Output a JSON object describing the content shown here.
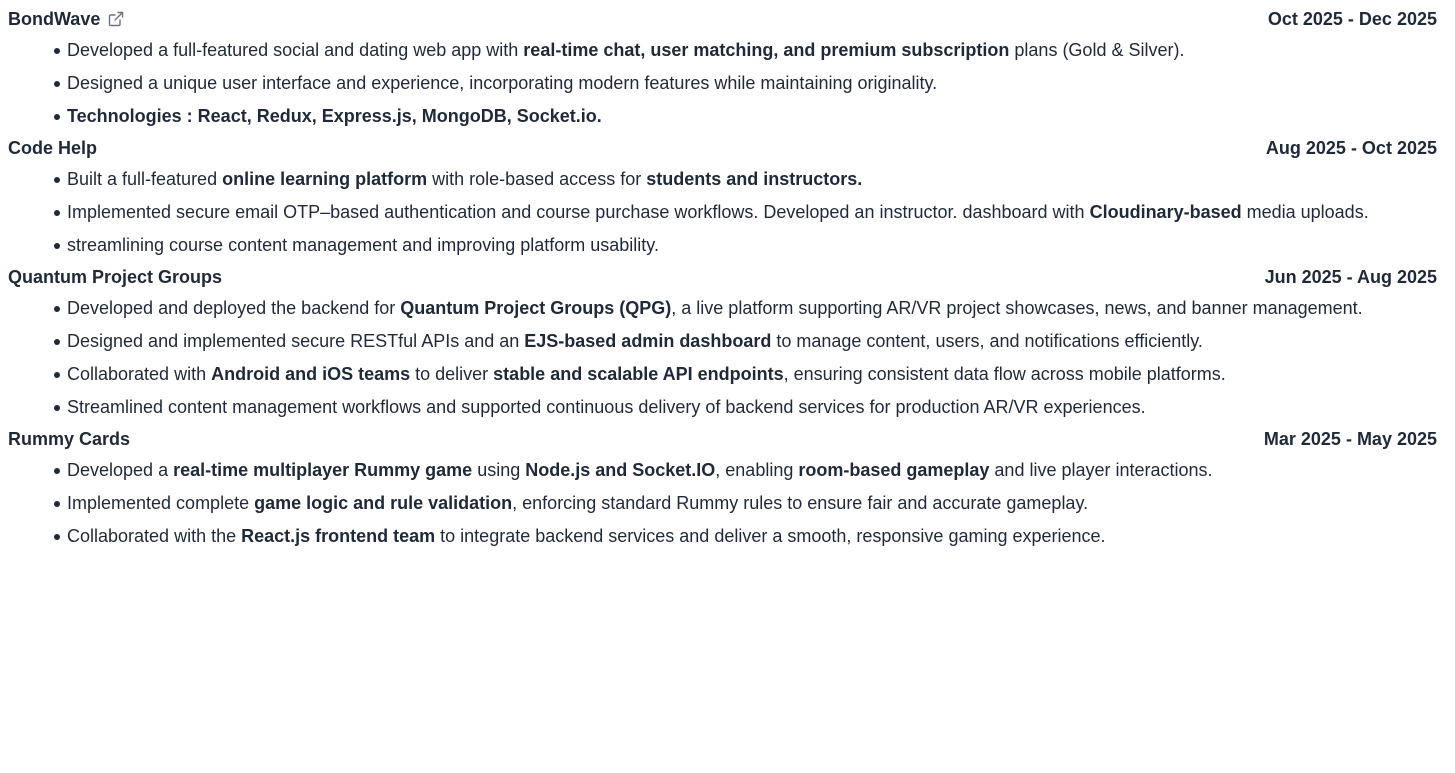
{
  "projects": [
    {
      "title": "BondWave",
      "has_link": true,
      "link_icon": "external-link-icon",
      "dates": "Oct 2025 - Dec 2025",
      "bullets": [
        [
          {
            "t": "Developed a full-featured social and dating web app with "
          },
          {
            "t": "real-time chat, user matching, and premium subscription",
            "b": true
          },
          {
            "t": " plans (Gold & Silver)."
          }
        ],
        [
          {
            "t": "Designed a unique user interface and experience, incorporating modern features while maintaining originality."
          }
        ],
        [
          {
            "t": "Technologies : React, Redux, Express.js, MongoDB, Socket.io.",
            "b": true
          }
        ]
      ]
    },
    {
      "title": "Code Help",
      "has_link": false,
      "dates": "Aug 2025 - Oct 2025",
      "bullets": [
        [
          {
            "t": "Built a full-featured "
          },
          {
            "t": "online learning platform",
            "b": true
          },
          {
            "t": " with role-based access for "
          },
          {
            "t": "students and instructors.",
            "b": true
          }
        ],
        [
          {
            "t": "Implemented secure email OTP–based authentication and course purchase workflows. Developed an instructor. dashboard with "
          },
          {
            "t": "Cloudinary-based",
            "b": true
          },
          {
            "t": " media uploads."
          }
        ],
        [
          {
            "t": "streamlining course content management and improving platform usability."
          }
        ]
      ]
    },
    {
      "title": "Quantum Project Groups",
      "has_link": false,
      "dates": "Jun 2025 - Aug 2025",
      "bullets": [
        [
          {
            "t": "Developed and deployed the backend for "
          },
          {
            "t": "Quantum Project Groups (QPG)",
            "b": true
          },
          {
            "t": ", a live platform supporting AR/VR project showcases, news, and banner management."
          }
        ],
        [
          {
            "t": "Designed and implemented secure RESTful APIs and an "
          },
          {
            "t": "EJS-based admin dashboard",
            "b": true
          },
          {
            "t": " to manage content, users, and notifications efficiently."
          }
        ],
        [
          {
            "t": "Collaborated with "
          },
          {
            "t": "Android and iOS teams",
            "b": true
          },
          {
            "t": " to deliver "
          },
          {
            "t": "stable and scalable API endpoints",
            "b": true
          },
          {
            "t": ", ensuring consistent data flow across mobile platforms."
          }
        ],
        [
          {
            "t": "Streamlined content management workflows and supported continuous delivery of backend services for production AR/VR experiences."
          }
        ]
      ]
    },
    {
      "title": "Rummy Cards",
      "has_link": false,
      "dates": "Mar 2025 - May 2025",
      "bullets": [
        [
          {
            "t": "Developed a "
          },
          {
            "t": "real-time multiplayer Rummy game",
            "b": true
          },
          {
            "t": " using "
          },
          {
            "t": "Node.js and Socket.IO",
            "b": true
          },
          {
            "t": ", enabling "
          },
          {
            "t": "room-based gameplay",
            "b": true
          },
          {
            "t": " and live player interactions."
          }
        ],
        [
          {
            "t": "Implemented complete "
          },
          {
            "t": "game logic and rule validation",
            "b": true
          },
          {
            "t": ", enforcing standard Rummy rules to ensure fair and accurate gameplay."
          }
        ],
        [
          {
            "t": "Collaborated with the "
          },
          {
            "t": "React.js frontend team",
            "b": true
          },
          {
            "t": " to integrate backend services and deliver a smooth, responsive gaming experience."
          }
        ]
      ]
    }
  ]
}
